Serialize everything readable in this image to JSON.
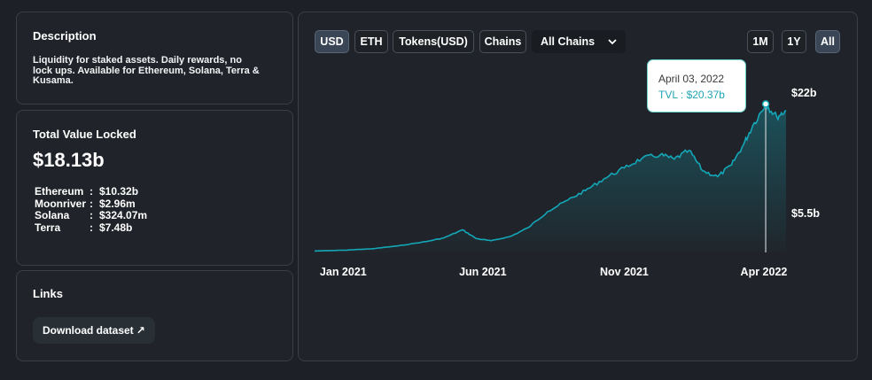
{
  "description": {
    "title": "Description",
    "text": "Liquidity for staked assets. Daily rewards, no lock ups. Available for Ethereum, Solana, Terra & Kusama."
  },
  "tvl": {
    "title": "Total Value Locked",
    "value": "$18.13b",
    "chains": [
      {
        "name": "Ethereum",
        "sep": ":",
        "value": "$10.32b"
      },
      {
        "name": "Moonriver",
        "sep": ":",
        "value": "$2.96m"
      },
      {
        "name": "Solana",
        "sep": ":",
        "value": "$324.07m"
      },
      {
        "name": "Terra",
        "sep": ":",
        "value": "$7.48b"
      }
    ]
  },
  "links": {
    "title": "Links",
    "download_label": "Download dataset",
    "download_icon": "↗"
  },
  "toolbar": {
    "usd": "USD",
    "eth": "ETH",
    "tokens": "Tokens(USD)",
    "chains": "Chains",
    "chains_select": "All Chains",
    "range_1m": "1M",
    "range_1y": "1Y",
    "range_all": "All"
  },
  "colors": {
    "line": "#14a7b8",
    "active_button": "#3a4656"
  },
  "chart_data": {
    "type": "area",
    "x": [
      "2020-12-01",
      "2021-01-01",
      "2021-02-01",
      "2021-03-01",
      "2021-04-01",
      "2021-04-20",
      "2021-05-10",
      "2021-05-25",
      "2021-06-10",
      "2021-07-01",
      "2021-07-20",
      "2021-08-10",
      "2021-09-01",
      "2021-09-20",
      "2021-10-10",
      "2021-11-01",
      "2021-11-20",
      "2021-12-10",
      "2021-12-25",
      "2022-01-10",
      "2022-01-25",
      "2022-02-10",
      "2022-02-25",
      "2022-03-10",
      "2022-03-20",
      "2022-04-03",
      "2022-04-15",
      "2022-04-25"
    ],
    "series": [
      {
        "values": [
          0.2,
          0.3,
          0.5,
          0.9,
          1.5,
          2.0,
          3.1,
          1.9,
          1.6,
          2.2,
          3.4,
          5.6,
          7.2,
          8.5,
          10.1,
          11.6,
          12.9,
          13.4,
          12.8,
          14.0,
          11.2,
          10.4,
          12.0,
          14.8,
          17.4,
          20.37,
          18.6,
          19.5
        ]
      }
    ],
    "x_ticks": [
      "Jan 2021",
      "Jun 2021",
      "Nov 2021",
      "Apr 2022"
    ],
    "y_ticks": [
      "$22b",
      "$5.5b"
    ],
    "tooltip": {
      "date": "April 03, 2022",
      "label": "TVL : $20.37b"
    }
  }
}
